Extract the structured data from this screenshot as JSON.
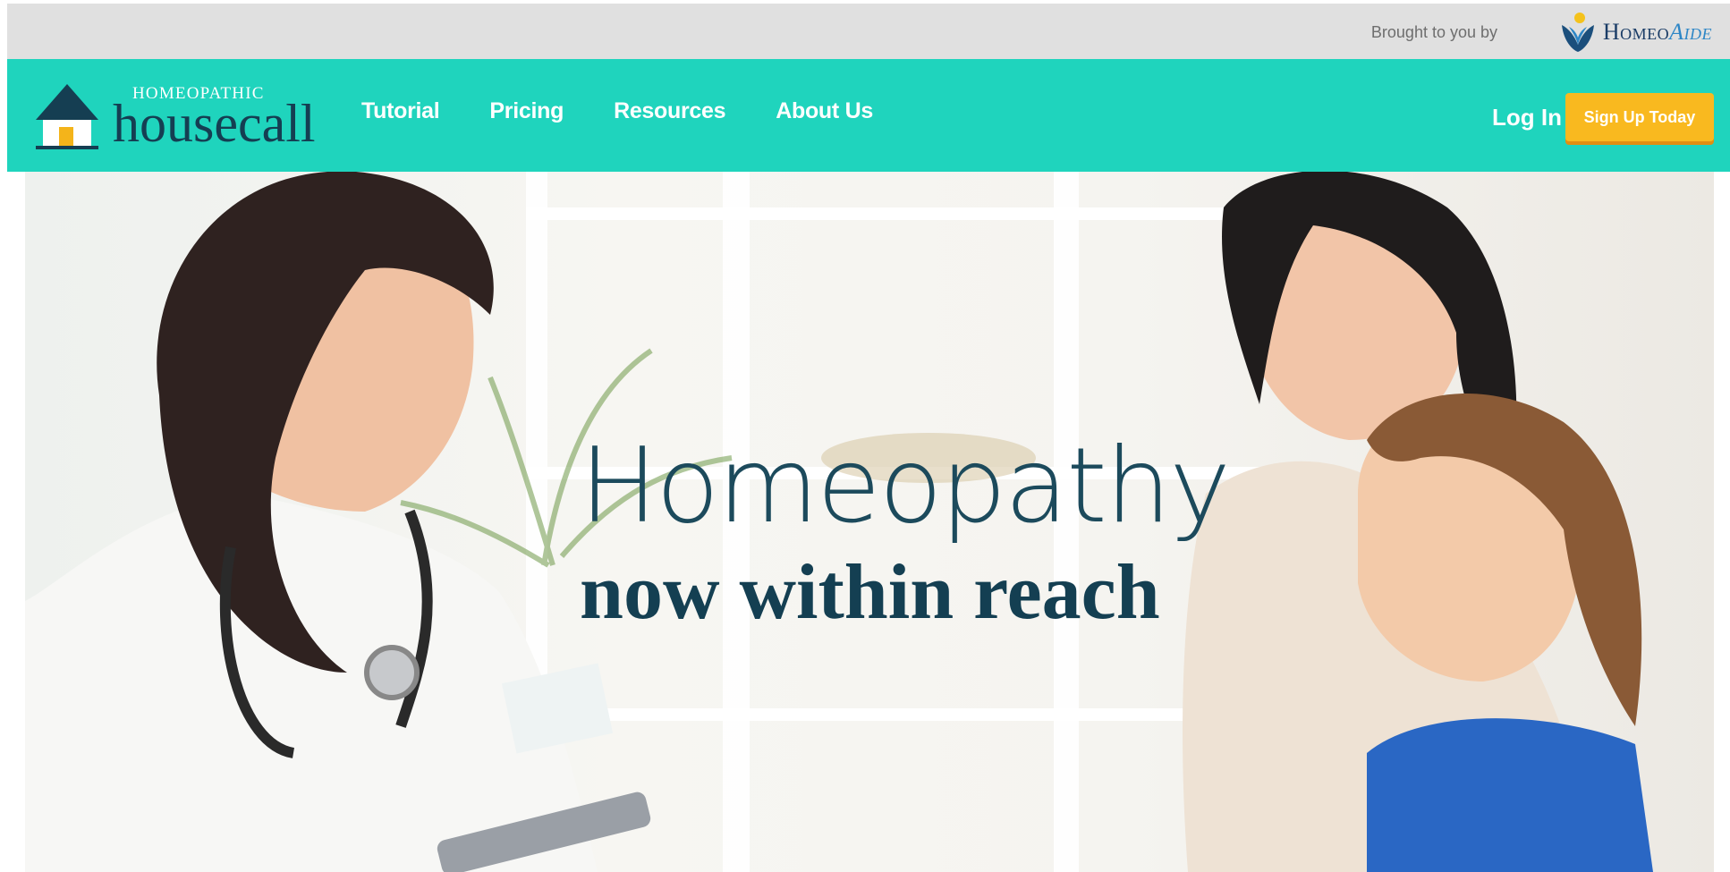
{
  "topbar": {
    "brought_text": "Brought to you by",
    "partner_name_main": "Homeo",
    "partner_name_accent": "Aide"
  },
  "brand": {
    "top": "HOMEOPATHIC",
    "main": "housecall"
  },
  "nav": {
    "items": [
      {
        "label": "Tutorial"
      },
      {
        "label": "Pricing"
      },
      {
        "label": "Resources"
      },
      {
        "label": "About Us"
      }
    ],
    "login": "Log In",
    "signup": "Sign Up Today"
  },
  "hero": {
    "line1": "Homeopathy",
    "line2": "now within reach"
  },
  "colors": {
    "nav_bg": "#1fd4bd",
    "topbar_bg": "#e0e0e0",
    "signup_bg": "#f9b91f",
    "brand_dark": "#153e52"
  }
}
